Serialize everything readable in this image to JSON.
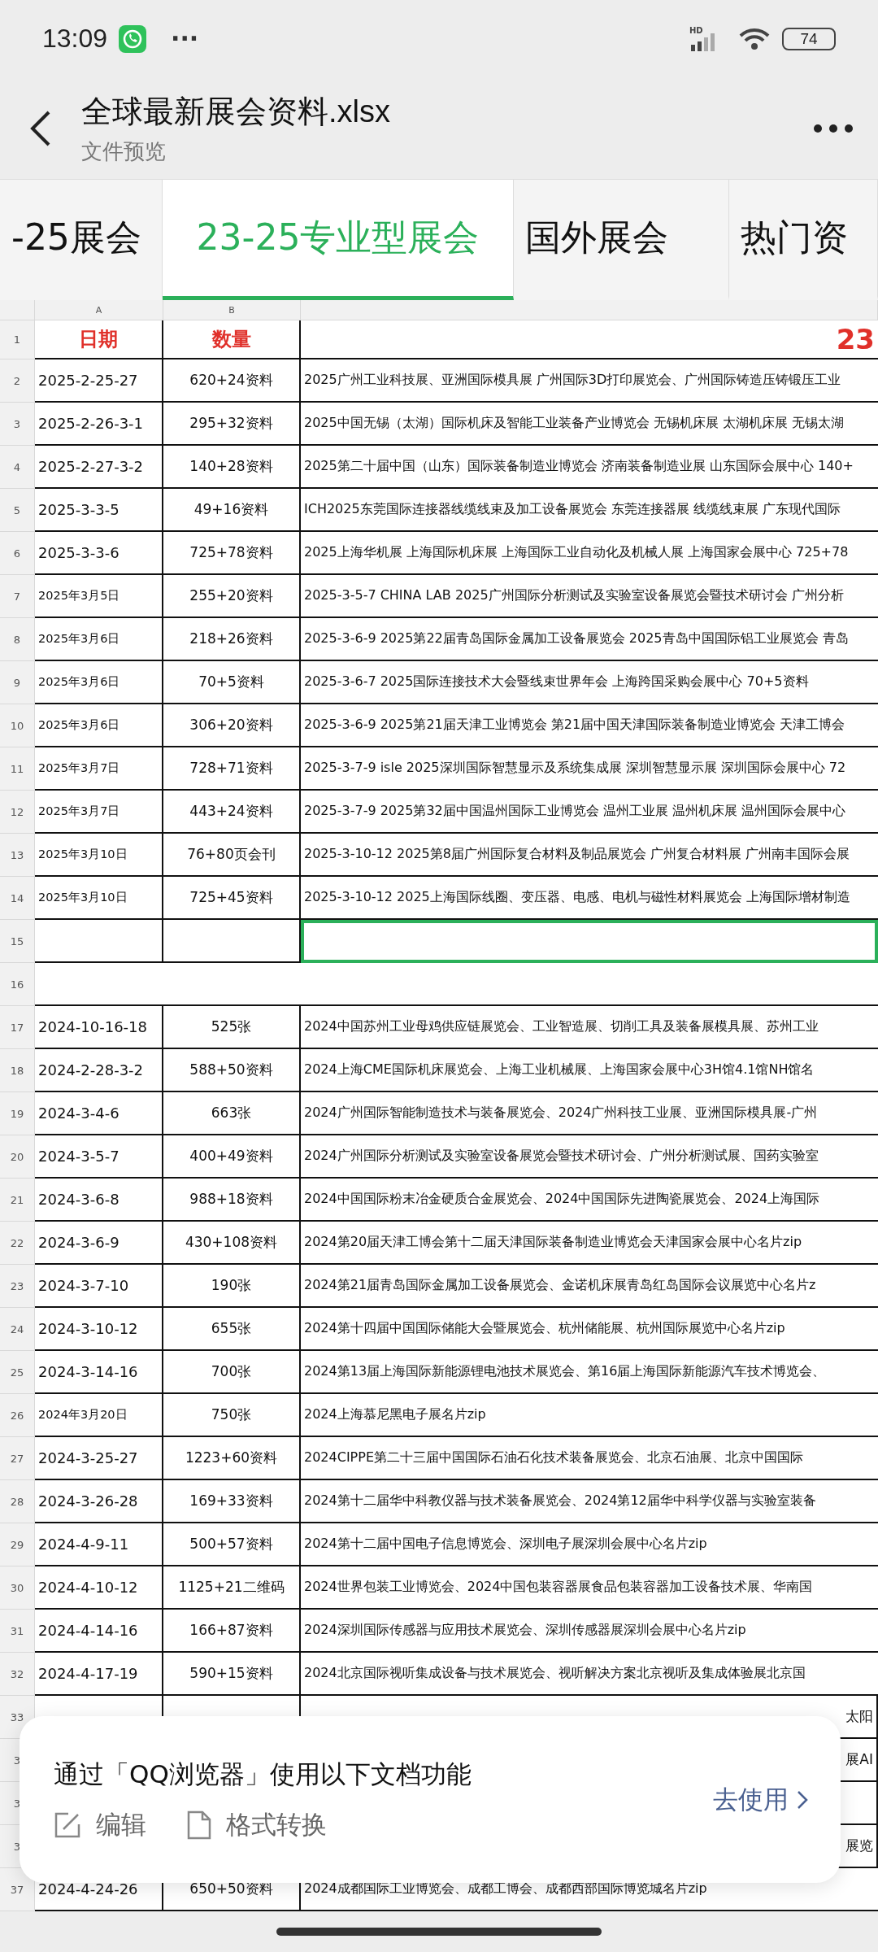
{
  "status_bar": {
    "time": "13:09",
    "more": "···",
    "network": "HD",
    "battery": "74"
  },
  "header": {
    "title": "全球最新展会资料.xlsx",
    "subtitle": "文件预览"
  },
  "tabs": [
    {
      "label": "-25展会",
      "selected": false
    },
    {
      "label": "23-25专业型展会",
      "selected": true
    },
    {
      "label": "国外展会",
      "selected": false
    },
    {
      "label": "热门资",
      "selected": false
    }
  ],
  "sheet": {
    "columns": [
      "A",
      "B"
    ],
    "header_row": {
      "num": "1",
      "a": "日期",
      "b": "数量",
      "c": "23"
    },
    "rows": [
      {
        "num": "2",
        "kind": "data",
        "date": {
          "text": "2025-2-25-27",
          "kind": "short"
        },
        "qty": "620+24资料",
        "desc": "2025广州工业科技展、亚洲国际模具展 广州国际3D打印展览会、广州国际铸造压铸锻压工业"
      },
      {
        "num": "3",
        "kind": "data",
        "date": {
          "text": "2025-2-26-3-1",
          "kind": "short"
        },
        "qty": "295+32资料",
        "desc": "2025中国无锡（太湖）国际机床及智能工业装备产业博览会 无锡机床展 太湖机床展 无锡太湖"
      },
      {
        "num": "4",
        "kind": "data",
        "date": {
          "text": "2025-2-27-3-2",
          "kind": "short"
        },
        "qty": "140+28资料",
        "desc": "2025第二十届中国（山东）国际装备制造业博览会 济南装备制造业展 山东国际会展中心 140+"
      },
      {
        "num": "5",
        "kind": "data",
        "date": {
          "text": "2025-3-3-5",
          "kind": "short"
        },
        "qty": "49+16资料",
        "desc": "ICH2025东莞国际连接器线缆线束及加工设备展览会 东莞连接器展 线缆线束展 广东现代国际"
      },
      {
        "num": "6",
        "kind": "data",
        "date": {
          "text": "2025-3-3-6",
          "kind": "short"
        },
        "qty": "725+78资料",
        "desc": "2025上海华机展 上海国际机床展 上海国际工业自动化及机械人展 上海国家会展中心 725+78"
      },
      {
        "num": "7",
        "kind": "data",
        "date": {
          "text": "2025年3月5日",
          "kind": "long"
        },
        "qty": "255+20资料",
        "desc": "2025-3-5-7 CHINA LAB 2025广州国际分析测试及实验室设备展览会暨技术研讨会 广州分析"
      },
      {
        "num": "8",
        "kind": "data",
        "date": {
          "text": "2025年3月6日",
          "kind": "long"
        },
        "qty": "218+26资料",
        "desc": "2025-3-6-9 2025第22届青岛国际金属加工设备展览会 2025青岛中国国际铝工业展览会 青岛"
      },
      {
        "num": "9",
        "kind": "data",
        "date": {
          "text": "2025年3月6日",
          "kind": "long"
        },
        "qty": "70+5资料",
        "desc": "2025-3-6-7 2025国际连接技术大会暨线束世界年会 上海跨国采购会展中心 70+5资料"
      },
      {
        "num": "10",
        "kind": "data",
        "date": {
          "text": "2025年3月6日",
          "kind": "long"
        },
        "qty": "306+20资料",
        "desc": "2025-3-6-9 2025第21届天津工业博览会 第21届中国天津国际装备制造业博览会 天津工博会"
      },
      {
        "num": "11",
        "kind": "data",
        "date": {
          "text": "2025年3月7日",
          "kind": "long"
        },
        "qty": "728+71资料",
        "desc": "2025-3-7-9 isle 2025深圳国际智慧显示及系统集成展 深圳智慧显示展 深圳国际会展中心 72"
      },
      {
        "num": "12",
        "kind": "data",
        "date": {
          "text": "2025年3月7日",
          "kind": "long"
        },
        "qty": "443+24资料",
        "desc": "2025-3-7-9 2025第32届中国温州国际工业博览会 温州工业展 温州机床展 温州国际会展中心"
      },
      {
        "num": "13",
        "kind": "data",
        "date": {
          "text": "2025年3月10日",
          "kind": "long"
        },
        "qty": "76+80页会刊",
        "desc": "2025-3-10-12 2025第8届广州国际复合材料及制品展览会 广州复合材料展 广州南丰国际会展"
      },
      {
        "num": "14",
        "kind": "data",
        "date": {
          "text": "2025年3月10日",
          "kind": "long"
        },
        "qty": "725+45资料",
        "desc": "2025-3-10-12 2025上海国际线圈、变压器、电感、电机与磁性材料展览会 上海国际增材制造"
      },
      {
        "num": "15",
        "kind": "data",
        "selected": true
      },
      {
        "num": "16",
        "kind": "spacer"
      },
      {
        "num": "17",
        "kind": "data",
        "date": {
          "text": "2024-10-16-18",
          "kind": "short"
        },
        "qty": "525张",
        "desc": "2024中国苏州工业母鸡供应链展览会、工业智造展、切削工具及装备展模具展、苏州工业"
      },
      {
        "num": "18",
        "kind": "data",
        "date": {
          "text": "2024-2-28-3-2",
          "kind": "short"
        },
        "qty": "588+50资料",
        "desc": "2024上海CME国际机床展览会、上海工业机械展、上海国家会展中心3H馆4.1馆NH馆名"
      },
      {
        "num": "19",
        "kind": "data",
        "date": {
          "text": "2024-3-4-6",
          "kind": "short"
        },
        "qty": "663张",
        "desc": "2024广州国际智能制造技术与装备展览会、2024广州科技工业展、亚洲国际模具展-广州"
      },
      {
        "num": "20",
        "kind": "data",
        "date": {
          "text": "2024-3-5-7",
          "kind": "short"
        },
        "qty": "400+49资料",
        "desc": "2024广州国际分析测试及实验室设备展览会暨技术研讨会、广州分析测试展、国药实验室"
      },
      {
        "num": "21",
        "kind": "data",
        "date": {
          "text": "2024-3-6-8",
          "kind": "short"
        },
        "qty": "988+18资料",
        "desc": "2024中国国际粉末冶金硬质合金展览会、2024中国国际先进陶瓷展览会、2024上海国际"
      },
      {
        "num": "22",
        "kind": "data",
        "date": {
          "text": "2024-3-6-9",
          "kind": "short"
        },
        "qty": "430+108资料",
        "desc": "2024第20届天津工博会第十二届天津国际装备制造业博览会天津国家会展中心名片zip"
      },
      {
        "num": "23",
        "kind": "data",
        "date": {
          "text": "2024-3-7-10",
          "kind": "short"
        },
        "qty": "190张",
        "desc": "2024第21届青岛国际金属加工设备展览会、金诺机床展青岛红岛国际会议展览中心名片z"
      },
      {
        "num": "24",
        "kind": "data",
        "date": {
          "text": "2024-3-10-12",
          "kind": "short"
        },
        "qty": "655张",
        "desc": "2024第十四届中国国际储能大会暨展览会、杭州储能展、杭州国际展览中心名片zip"
      },
      {
        "num": "25",
        "kind": "data",
        "date": {
          "text": "2024-3-14-16",
          "kind": "short"
        },
        "qty": "700张",
        "desc": "2024第13届上海国际新能源锂电池技术展览会、第16届上海国际新能源汽车技术博览会、"
      },
      {
        "num": "26",
        "kind": "data",
        "date": {
          "text": "2024年3月20日",
          "kind": "long"
        },
        "qty": "750张",
        "desc": "2024上海慕尼黑电子展名片zip"
      },
      {
        "num": "27",
        "kind": "data",
        "date": {
          "text": "2024-3-25-27",
          "kind": "short"
        },
        "qty": "1223+60资料",
        "desc": "2024CIPPE第二十三届中国国际石油石化技术装备展览会、北京石油展、北京中国国际"
      },
      {
        "num": "28",
        "kind": "data",
        "date": {
          "text": "2024-3-26-28",
          "kind": "short"
        },
        "qty": "169+33资料",
        "desc": "2024第十二届华中科教仪器与技术装备展览会、2024第12届华中科学仪器与实验室装备"
      },
      {
        "num": "29",
        "kind": "data",
        "date": {
          "text": "2024-4-9-11",
          "kind": "short"
        },
        "qty": "500+57资料",
        "desc": "2024第十二届中国电子信息博览会、深圳电子展深圳会展中心名片zip"
      },
      {
        "num": "30",
        "kind": "data",
        "date": {
          "text": "2024-4-10-12",
          "kind": "short"
        },
        "qty": "1125+21二维码",
        "desc": "2024世界包装工业博览会、2024中国包装容器展食品包装容器加工设备技术展、华南国"
      },
      {
        "num": "31",
        "kind": "data",
        "date": {
          "text": "2024-4-14-16",
          "kind": "short"
        },
        "qty": "166+87资料",
        "desc": "2024深圳国际传感器与应用技术展览会、深圳传感器展深圳会展中心名片zip"
      },
      {
        "num": "32",
        "kind": "data",
        "date": {
          "text": "2024-4-17-19",
          "kind": "short"
        },
        "qty": "590+15资料",
        "desc": "2024北京国际视听集成设备与技术展览会、视听解决方案北京视听及集成体验展北京国"
      },
      {
        "num": "33",
        "kind": "hidden",
        "tail": "太阳"
      },
      {
        "num": "3",
        "kind": "hidden",
        "tail": "展AI"
      },
      {
        "num": "3",
        "kind": "hidden"
      },
      {
        "num": "3",
        "kind": "hidden",
        "tail": "展览"
      },
      {
        "num": "37",
        "kind": "data",
        "date": {
          "text": "2024-4-24-26",
          "kind": "short"
        },
        "qty": "650+50资料",
        "desc": "2024成都国际工业博览会、成都工博会、成都西部国际博览城名片zip"
      }
    ]
  },
  "banner": {
    "title": "通过「QQ浏览器」使用以下文档功能",
    "actions": [
      {
        "kind": "edit",
        "label": "编辑"
      },
      {
        "kind": "file",
        "label": "格式转换"
      }
    ],
    "cta": "去使用"
  }
}
